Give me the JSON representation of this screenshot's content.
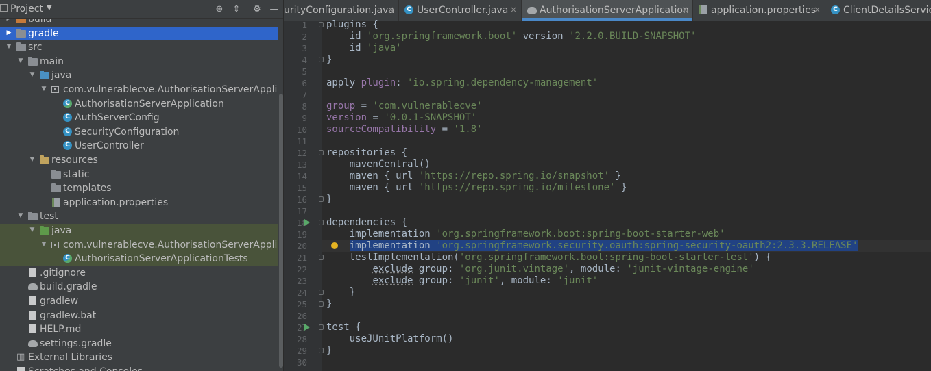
{
  "project_panel": {
    "title": "Project",
    "tree": [
      {
        "label": "build",
        "depth": 0,
        "arrow": "right",
        "icon": "folder-orange-icon"
      },
      {
        "label": "gradle",
        "depth": 0,
        "arrow": "right",
        "icon": "folder-icon",
        "selected": true
      },
      {
        "label": "src",
        "depth": 0,
        "arrow": "down",
        "icon": "folder-icon"
      },
      {
        "label": "main",
        "depth": 1,
        "arrow": "down",
        "icon": "module-folder-icon"
      },
      {
        "label": "java",
        "depth": 2,
        "arrow": "down",
        "icon": "source-folder-icon"
      },
      {
        "label": "com.vulnerablecve.AuthorisationServerApplicatio",
        "depth": 3,
        "arrow": "down",
        "icon": "package-icon"
      },
      {
        "label": "AuthorisationServerApplication",
        "depth": 4,
        "icon": "spring-boot-class-icon"
      },
      {
        "label": "AuthServerConfig",
        "depth": 4,
        "icon": "class-icon"
      },
      {
        "label": "SecurityConfiguration",
        "depth": 4,
        "icon": "class-icon"
      },
      {
        "label": "UserController",
        "depth": 4,
        "icon": "class-icon"
      },
      {
        "label": "resources",
        "depth": 2,
        "arrow": "down",
        "icon": "resources-folder-icon"
      },
      {
        "label": "static",
        "depth": 3,
        "icon": "folder-icon"
      },
      {
        "label": "templates",
        "depth": 3,
        "icon": "folder-icon"
      },
      {
        "label": "application.properties",
        "depth": 3,
        "icon": "properties-file-icon"
      },
      {
        "label": "test",
        "depth": 1,
        "arrow": "down",
        "icon": "module-folder-icon"
      },
      {
        "label": "java",
        "depth": 2,
        "arrow": "down",
        "icon": "test-folder-icon",
        "test": true
      },
      {
        "label": "com.vulnerablecve.AuthorisationServerApplicatio",
        "depth": 3,
        "arrow": "down",
        "icon": "package-icon",
        "test": true
      },
      {
        "label": "AuthorisationServerApplicationTests",
        "depth": 4,
        "icon": "spring-boot-class-icon",
        "test": true
      },
      {
        "label": ".gitignore",
        "depth": 1,
        "icon": "text-file-icon"
      },
      {
        "label": "build.gradle",
        "depth": 1,
        "icon": "gradle-file-icon"
      },
      {
        "label": "gradlew",
        "depth": 1,
        "icon": "text-file-icon"
      },
      {
        "label": "gradlew.bat",
        "depth": 1,
        "icon": "text-file-icon"
      },
      {
        "label": "HELP.md",
        "depth": 1,
        "icon": "text-file-icon"
      },
      {
        "label": "settings.gradle",
        "depth": 1,
        "icon": "gradle-file-icon"
      },
      {
        "label": "External Libraries",
        "depth": 0,
        "icon": "libraries-icon"
      },
      {
        "label": "Scratches and Consoles",
        "depth": 0,
        "icon": "scratches-icon"
      }
    ]
  },
  "tabs": [
    {
      "label": "urityConfiguration.java",
      "icon": "",
      "close": "×"
    },
    {
      "label": "UserController.java",
      "icon": "class-icon",
      "close": "×"
    },
    {
      "label": "AuthorisationServerApplication",
      "icon": "gradle-file-icon",
      "close": "×",
      "active": true
    },
    {
      "label": "application.properties",
      "icon": "properties-file-icon",
      "close": "×"
    },
    {
      "label": "ClientDetailsServiceE",
      "icon": "class-icon",
      "close": ""
    }
  ],
  "editor": {
    "current_line": 20,
    "lines": [
      [
        [
          "plugins {",
          "p"
        ]
      ],
      [
        [
          "    id ",
          "p"
        ],
        [
          "'org.springframework.boot'",
          "s"
        ],
        [
          " version ",
          "p"
        ],
        [
          "'2.2.0.BUILD-SNAPSHOT'",
          "s"
        ]
      ],
      [
        [
          "    id ",
          "p"
        ],
        [
          "'java'",
          "s"
        ]
      ],
      [
        [
          "}",
          "p"
        ]
      ],
      [],
      [
        [
          "apply ",
          "p"
        ],
        [
          "plugin",
          "k"
        ],
        [
          ": ",
          "p"
        ],
        [
          "'io.spring.dependency-management'",
          "s"
        ]
      ],
      [],
      [
        [
          "group",
          "k"
        ],
        [
          " = ",
          "p"
        ],
        [
          "'com.vulnerablecve'",
          "s"
        ]
      ],
      [
        [
          "version",
          "k"
        ],
        [
          " = ",
          "p"
        ],
        [
          "'0.0.1-SNAPSHOT'",
          "s"
        ]
      ],
      [
        [
          "sourceCompatibility",
          "k"
        ],
        [
          " = ",
          "p"
        ],
        [
          "'1.8'",
          "s"
        ]
      ],
      [],
      [
        [
          "repositories {",
          "p"
        ]
      ],
      [
        [
          "    mavenCentral()",
          "p"
        ]
      ],
      [
        [
          "    maven { url ",
          "p"
        ],
        [
          "'https://repo.spring.io/snapshot'",
          "s"
        ],
        [
          " }",
          "p"
        ]
      ],
      [
        [
          "    maven { url ",
          "p"
        ],
        [
          "'https://repo.spring.io/milestone'",
          "s"
        ],
        [
          " }",
          "p"
        ]
      ],
      [
        [
          "}",
          "p"
        ]
      ],
      [],
      [
        [
          "dependencies {",
          "p"
        ]
      ],
      [
        [
          "    implementation ",
          "p"
        ],
        [
          "'org.springframework.boot:spring-boot-starter-web'",
          "s"
        ]
      ],
      [
        [
          "    ",
          "p"
        ],
        [
          "implementation ",
          "sel"
        ],
        [
          "'org.springframework.security.oauth:spring-security-oauth2:2.3.3.RELEASE'",
          "sels"
        ]
      ],
      [
        [
          "    testImplementation(",
          "p"
        ],
        [
          "'org.springframework.boot:spring-boot-starter-test'",
          "s"
        ],
        [
          ") {",
          "p"
        ]
      ],
      [
        [
          "        ",
          "p"
        ],
        [
          "exclude",
          "d"
        ],
        [
          " group",
          "l"
        ],
        [
          ": ",
          "p"
        ],
        [
          "'org.junit.vintage'",
          "s"
        ],
        [
          ", module",
          "l"
        ],
        [
          ": ",
          "p"
        ],
        [
          "'junit-vintage-engine'",
          "s"
        ]
      ],
      [
        [
          "        ",
          "p"
        ],
        [
          "exclude",
          "d"
        ],
        [
          " group",
          "l"
        ],
        [
          ": ",
          "p"
        ],
        [
          "'junit'",
          "s"
        ],
        [
          ", module",
          "l"
        ],
        [
          ": ",
          "p"
        ],
        [
          "'junit'",
          "s"
        ]
      ],
      [
        [
          "    }",
          "p"
        ]
      ],
      [
        [
          "}",
          "p"
        ]
      ],
      [],
      [
        [
          "test {",
          "p"
        ]
      ],
      [
        [
          "    useJUnitPlatform()",
          "p"
        ]
      ],
      [
        [
          "}",
          "p"
        ]
      ],
      []
    ],
    "run_markers": [
      18,
      27
    ],
    "bulb_line": 20,
    "fold_lines": [
      1,
      4,
      12,
      16,
      18,
      21,
      24,
      25,
      27,
      29
    ]
  },
  "colors": {
    "accent": "#4a88c7",
    "selection": "#2f65ca",
    "test_bg": "#49533a",
    "string": "#6a8759",
    "keyword": "#9876aa"
  }
}
